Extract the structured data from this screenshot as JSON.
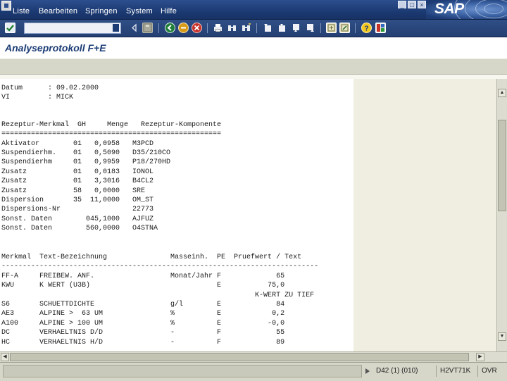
{
  "menu": {
    "items": [
      "Liste",
      "Bearbeiten",
      "Springen",
      "System",
      "Hilfe"
    ]
  },
  "brand": {
    "logo": "SAP"
  },
  "window_controls": [
    "minimize",
    "restore",
    "close"
  ],
  "toolbar": {
    "command_field_value": "",
    "icons": [
      "enter-icon",
      "save-icon",
      "back-icon",
      "exit-icon",
      "cancel-icon",
      "print-icon",
      "find-icon",
      "find-next-icon",
      "first-page-icon",
      "previous-page-icon",
      "next-page-icon",
      "last-page-icon",
      "create-session-icon",
      "shortcut-icon",
      "help-icon",
      "layout-icon"
    ]
  },
  "title": "Analyseprotokoll F+E",
  "report": {
    "lines": [
      "Datum      : 09.02.2000",
      "VI         : MICK",
      "",
      "Rezeptur-Merkmal  GH     Menge   Rezeptur-Komponente",
      "====================================================",
      "Aktivator        01   0,0958   M3PCD",
      "Suspendierhm.    01   0,5090   D35/210CO",
      "Suspendierhm     01   0,9959   P18/270HD",
      "Zusatz           01   0,0183   IONOL",
      "Zusatz           01   3,3016   B4CL2",
      "Zusatz           58   0,0000   SRE",
      "Dispersion       35  11,0000   OM_ST",
      "Dispersions-Nr                 22773",
      "Sonst. Daten        045,1000   AJFUZ",
      "Sonst. Daten        560,0000   O4STNA",
      "",
      "",
      "Merkmal  Text-Bezeichnung               Masseinh.  PE  Pruefwert / Text",
      "---------------------------------------------------------------------------",
      "FF-A     FREIBEW. ANF.                  Monat/Jahr F             65",
      "KWU      K WERT (U3B)                              E           75,0",
      "                                                            K-WERT ZU TIEF",
      "S6       SCHUETTDICHTE                  g/l        E             84",
      "AE3      ALPINE >  63 UM                %          E            0,2",
      "A100     ALPINE > 100 UM                %          E           -0,0",
      "DC       VERHAELTNIS D/D                -          F             55",
      "HC       VERHAELTNIS H/D                -          F             89"
    ]
  },
  "status": {
    "system": "D42 (1) (010)",
    "server": "H2VT71K",
    "mode": "OVR"
  }
}
